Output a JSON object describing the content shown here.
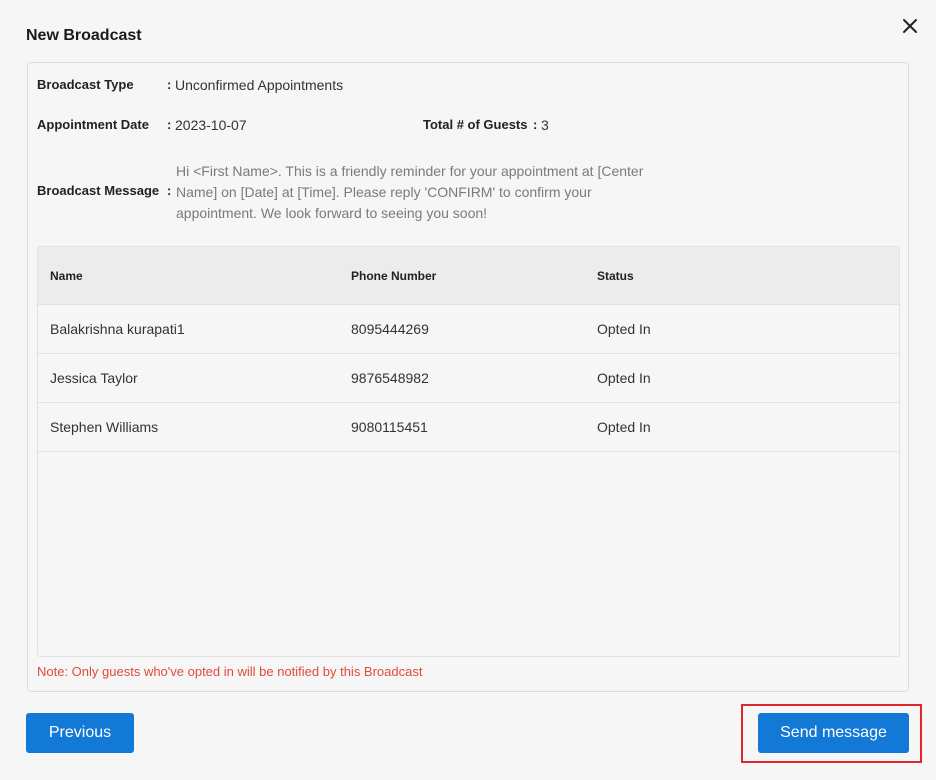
{
  "dialog": {
    "title": "New Broadcast",
    "close_icon": "close-icon"
  },
  "details": {
    "broadcast_type_label": "Broadcast Type",
    "broadcast_type_value": "Unconfirmed Appointments",
    "appointment_date_label": "Appointment Date",
    "appointment_date_value": "2023-10-07",
    "total_guests_label": "Total # of Guests",
    "total_guests_value": "3",
    "broadcast_message_label": "Broadcast Message",
    "broadcast_message_value": "Hi <First Name>. This is a friendly reminder for your appointment at [Center Name] on [Date] at [Time]. Please reply 'CONFIRM' to confirm your appointment.  We look forward to seeing you soon!",
    "colon": ":"
  },
  "table": {
    "headers": [
      "Name",
      "Phone Number",
      "Status"
    ],
    "rows": [
      [
        "Balakrishna kurapati1",
        "8095444269",
        "Opted In"
      ],
      [
        "Jessica Taylor",
        "9876548982",
        "Opted In"
      ],
      [
        "Stephen Williams",
        "9080115451",
        "Opted In"
      ]
    ]
  },
  "note": "Note: Only guests who've opted in will be notified by this Broadcast",
  "buttons": {
    "previous": "Previous",
    "send": "Send message"
  },
  "colors": {
    "primary": "#1379d6",
    "note": "#e04b3c",
    "highlight": "#e0262a"
  }
}
